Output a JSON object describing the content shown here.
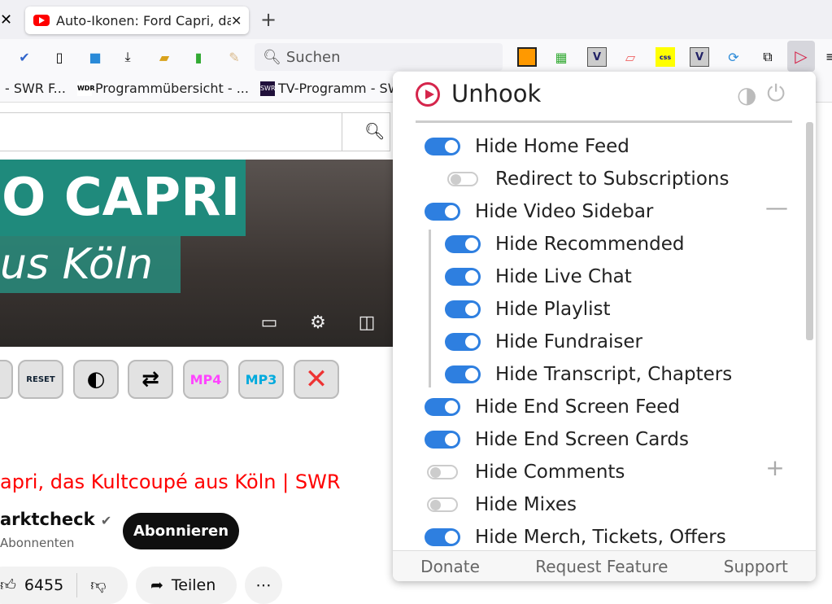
{
  "browser": {
    "tab_title": "Auto-Ikonen: Ford Capri, da",
    "new_tab": "+",
    "search_placeholder": "Suchen",
    "bookmarks": [
      "- SWR F...",
      "Programmübersicht - ...",
      "TV-Programm - SW"
    ],
    "bookmark_icons": [
      "WDR",
      "SWR"
    ],
    "ext_icons": [
      "css",
      "V",
      "V"
    ]
  },
  "video": {
    "banner_line1": "O CAPRI",
    "banner_line2": "us Köln",
    "title": "apri, das Kultcoupé aus Köln | SWR",
    "channel": "arktcheck",
    "subscribers": "Abonnenten",
    "subscribe": "Abonnieren",
    "likes": "6455",
    "share": "Teilen",
    "more": "⋯",
    "ext_buttons": [
      "RESET",
      "◐",
      "⇄",
      "MP4",
      "MP3",
      "✕"
    ]
  },
  "popup": {
    "title": "Unhook",
    "options": [
      {
        "label": "Hide Home Feed",
        "on": true,
        "level": 0
      },
      {
        "label": "Redirect to Subscriptions",
        "on": false,
        "level": 1
      },
      {
        "label": "Hide Video Sidebar",
        "on": true,
        "level": 0,
        "sign": "—"
      },
      {
        "label": "Hide Recommended",
        "on": true,
        "level": 1
      },
      {
        "label": "Hide Live Chat",
        "on": true,
        "level": 1
      },
      {
        "label": "Hide Playlist",
        "on": true,
        "level": 1
      },
      {
        "label": "Hide Fundraiser",
        "on": true,
        "level": 1
      },
      {
        "label": "Hide Transcript, Chapters",
        "on": true,
        "level": 1
      },
      {
        "label": "Hide End Screen Feed",
        "on": true,
        "level": 0
      },
      {
        "label": "Hide End Screen Cards",
        "on": true,
        "level": 0
      },
      {
        "label": "Hide Comments",
        "on": false,
        "level": 0,
        "sign": "+"
      },
      {
        "label": "Hide Mixes",
        "on": false,
        "level": 0
      },
      {
        "label": "Hide Merch, Tickets, Offers",
        "on": true,
        "level": 0
      }
    ],
    "footer": [
      "Donate",
      "Request Feature",
      "Support"
    ],
    "accent": "#2e7fe0"
  }
}
